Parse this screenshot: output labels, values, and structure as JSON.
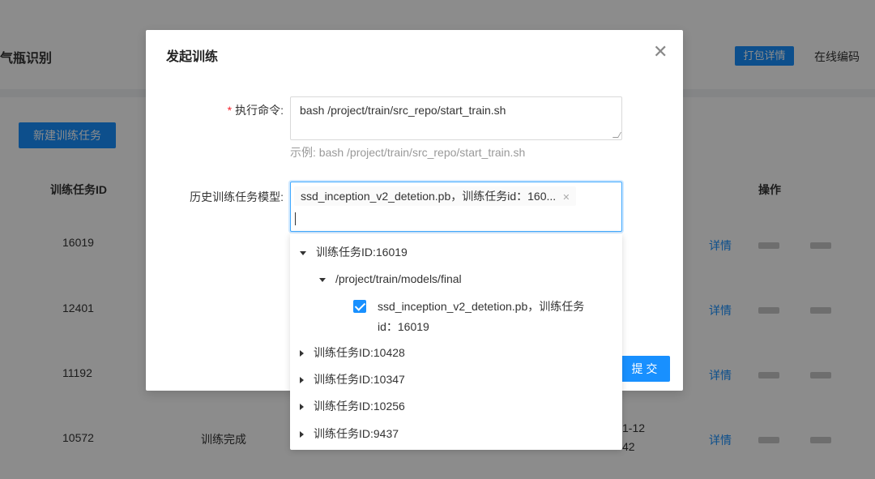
{
  "page": {
    "title": "气瓶识别",
    "pack_button": "打包详情",
    "online_code": "在线编码",
    "new_task_button": "新建训练任务"
  },
  "table": {
    "headers": {
      "id": "训练任务ID",
      "ops": "操作"
    },
    "rows": [
      {
        "id": "16019",
        "status": "",
        "detail": "详情"
      },
      {
        "id": "12401",
        "status": "",
        "detail": "详情"
      },
      {
        "id": "11192",
        "status": "",
        "detail": "详情"
      },
      {
        "id": "10572",
        "status": "训练完成",
        "date1": "1-12",
        "date2": "42",
        "detail": "详情"
      }
    ]
  },
  "modal": {
    "title": "发起训练",
    "command_label": "执行命令:",
    "command_value": "bash /project/train/src_repo/start_train.sh",
    "command_hint": "示例: bash /project/train/src_repo/start_train.sh",
    "model_label": "历史训练任务模型:",
    "selected_tag": "ssd_inception_v2_detetion.pb，训练任务id：160...",
    "submit": "提 交"
  },
  "tree": {
    "nodes": [
      {
        "label": "训练任务ID:16019",
        "expanded": true
      },
      {
        "label": "/project/train/models/final",
        "expanded": true
      },
      {
        "label": "ssd_inception_v2_detetion.pb，训练任务",
        "label2": "id：16019",
        "checked": true
      },
      {
        "label": "训练任务ID:10428"
      },
      {
        "label": "训练任务ID:10347"
      },
      {
        "label": "训练任务ID:10256"
      },
      {
        "label": "训练任务ID:9437"
      }
    ]
  },
  "colors": {
    "primary": "#1890ff",
    "required": "#f5222d"
  }
}
